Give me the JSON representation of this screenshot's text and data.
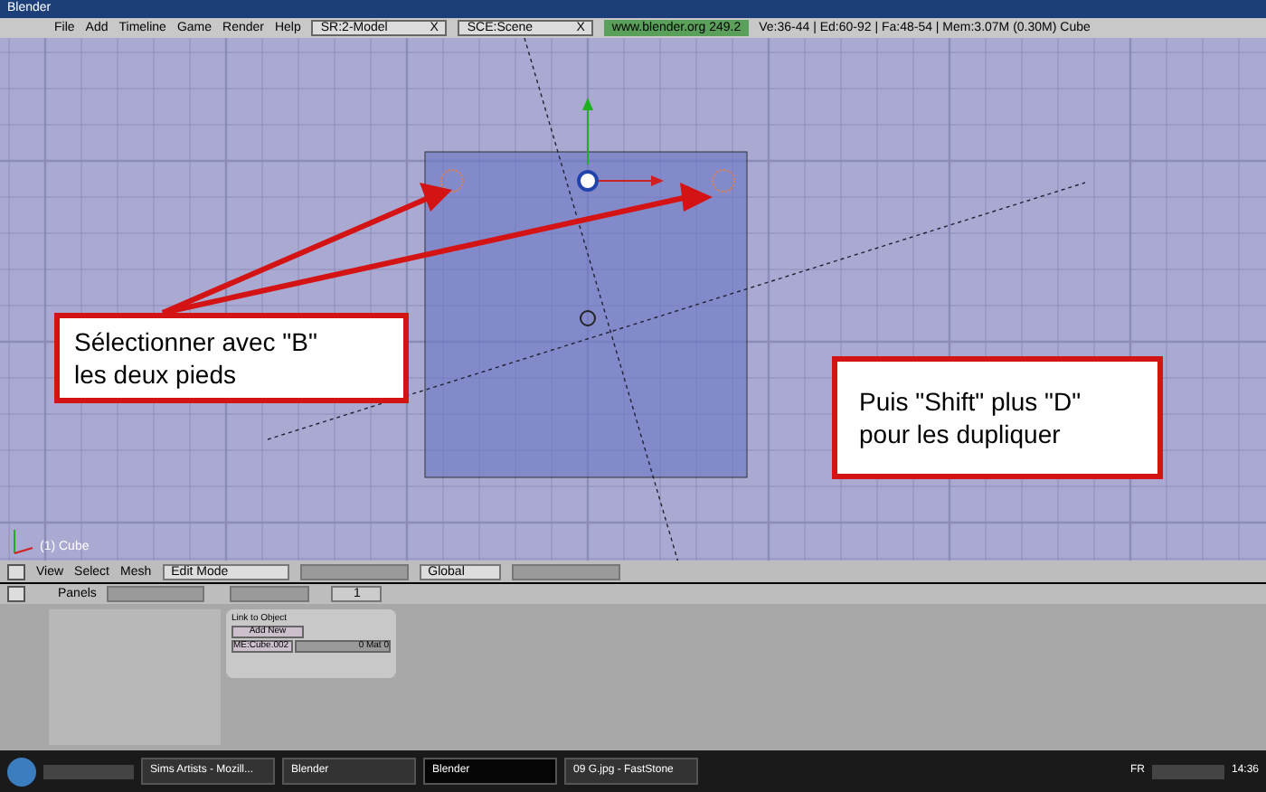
{
  "window": {
    "title": "Blender"
  },
  "menu": [
    "File",
    "Add",
    "Timeline",
    "Game",
    "Render",
    "Help"
  ],
  "screen_field": {
    "value": "SR:2-Model",
    "close": "X"
  },
  "scene_field": {
    "value": "SCE:Scene",
    "close": "X"
  },
  "version": "www.blender.org 249.2",
  "stats": "Ve:36-44 | Ed:60-92 | Fa:48-54 | Mem:3.07M (0.30M) Cube",
  "viewport": {
    "object_label": "(1) Cube"
  },
  "callouts": [
    {
      "lines": [
        "Sélectionner avec \"B\"",
        "les deux pieds"
      ]
    },
    {
      "lines": [
        "Puis \"Shift\" plus \"D\"",
        "pour les dupliquer"
      ]
    }
  ],
  "view_header": {
    "menus": [
      "View",
      "Select",
      "Mesh"
    ],
    "mode": "Edit Mode",
    "orientation": "Global"
  },
  "buttons_header": {
    "label": "Panels",
    "frame": "1"
  },
  "panel": {
    "title": "Link to Object",
    "add": "Add New",
    "mesh": "ME:Cube.002",
    "mat": "0 Mat 0"
  },
  "taskbar": {
    "items": [
      {
        "label": "Sims Artists - Mozill...",
        "selected": false
      },
      {
        "label": "Blender",
        "selected": false
      },
      {
        "label": "Blender",
        "selected": true
      },
      {
        "label": "09 G.jpg - FastStone",
        "selected": false
      }
    ],
    "lang": "FR",
    "time": "14:36"
  }
}
